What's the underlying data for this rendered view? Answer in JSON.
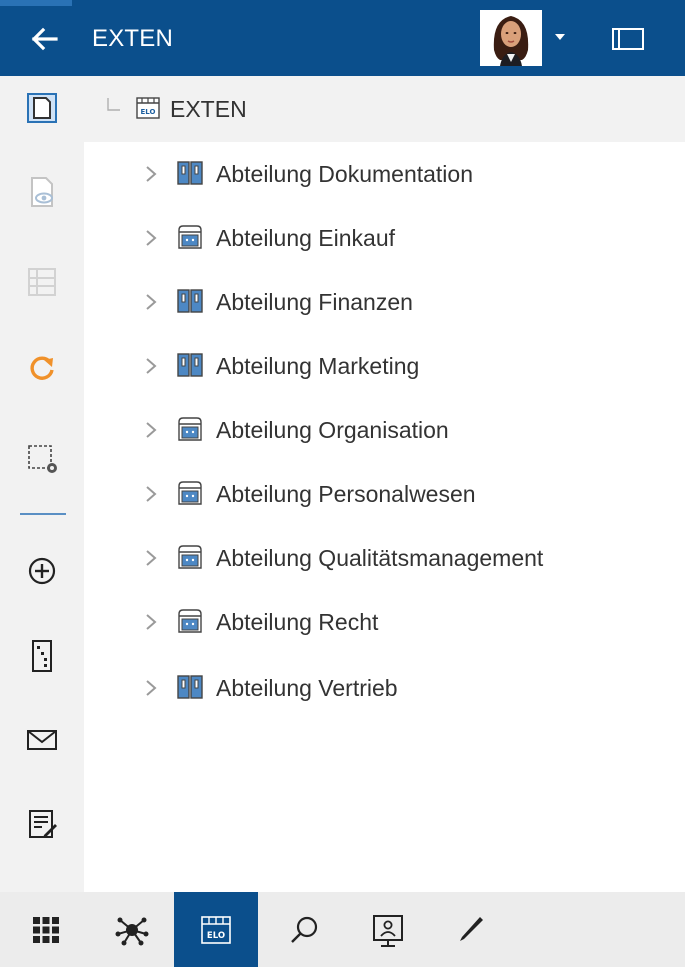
{
  "header": {
    "title": "EXTEN",
    "back_icon": "arrow-left-icon",
    "user_avatar": "user-avatar",
    "colors": {
      "bar": "#0b4f8c",
      "text": "#ffffff"
    }
  },
  "left_toolbar": {
    "items": [
      {
        "icon": "new-document-icon",
        "state": "selected"
      },
      {
        "icon": "preview-document-icon",
        "state": "disabled"
      },
      {
        "icon": "list-view-icon",
        "state": "disabled"
      },
      {
        "icon": "refresh-icon",
        "state": "normal",
        "color": "#f0912a"
      },
      {
        "icon": "selection-settings-icon",
        "state": "normal"
      },
      {
        "icon": "add-circle-icon",
        "state": "normal"
      },
      {
        "icon": "folder-structure-icon",
        "state": "normal"
      },
      {
        "icon": "mail-icon",
        "state": "normal"
      },
      {
        "icon": "edit-note-icon",
        "state": "normal"
      }
    ]
  },
  "tree": {
    "root": {
      "label": "EXTEN",
      "icon": "archive-icon"
    },
    "items": [
      {
        "label": "Abteilung Dokumentation",
        "icon": "binder-icon"
      },
      {
        "label": "Abteilung Einkauf",
        "icon": "cabinet-icon"
      },
      {
        "label": "Abteilung Finanzen",
        "icon": "binder-icon"
      },
      {
        "label": "Abteilung Marketing",
        "icon": "binder-icon"
      },
      {
        "label": "Abteilung Organisation",
        "icon": "cabinet-icon"
      },
      {
        "label": "Abteilung Personalwesen",
        "icon": "cabinet-icon"
      },
      {
        "label": "Abteilung Qualitätsmanagement",
        "icon": "cabinet-icon"
      },
      {
        "label": "Abteilung Recht",
        "icon": "cabinet-icon"
      },
      {
        "label": "Abteilung Vertrieb",
        "icon": "binder-icon"
      }
    ]
  },
  "bottom_bar": {
    "items": [
      {
        "icon": "apps-grid-icon",
        "active": false
      },
      {
        "icon": "network-icon",
        "active": false
      },
      {
        "icon": "repository-icon",
        "active": true
      },
      {
        "icon": "search-icon",
        "active": false
      },
      {
        "icon": "presentation-icon",
        "active": false
      },
      {
        "icon": "pen-icon",
        "active": false
      }
    ]
  }
}
